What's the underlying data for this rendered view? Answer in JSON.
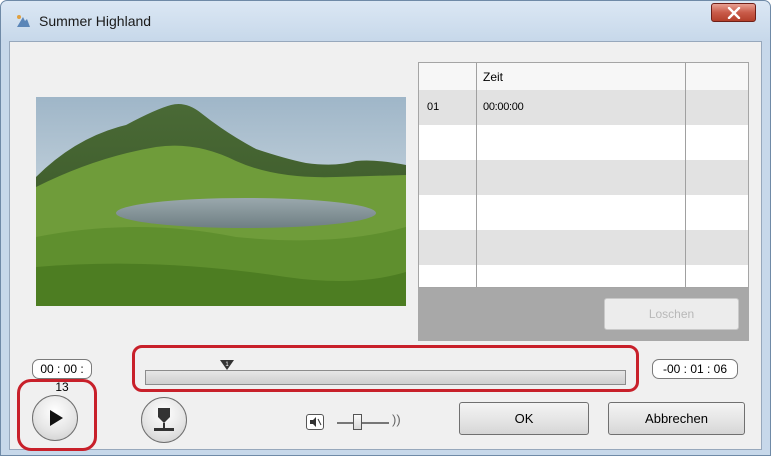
{
  "window": {
    "title": "Summer Highland",
    "close_icon": "close-icon"
  },
  "markers_table": {
    "columns": [
      "",
      "Zeit",
      ""
    ],
    "rows": [
      {
        "index": "01",
        "time": "00:00:00"
      },
      {
        "index": "",
        "time": ""
      },
      {
        "index": "",
        "time": ""
      },
      {
        "index": "",
        "time": ""
      },
      {
        "index": "",
        "time": ""
      },
      {
        "index": "",
        "time": ""
      }
    ],
    "delete_label": "Loschen"
  },
  "playback": {
    "elapsed": "00 : 00 : 13",
    "remaining": "-00 : 01 : 06",
    "marker_label": "1",
    "play_icon": "play-icon",
    "add_marker_icon": "add-marker-icon",
    "mute_icon": "mute-icon",
    "volume_icon": "volume-wave-icon"
  },
  "footer": {
    "ok_label": "OK",
    "cancel_label": "Abbrechen"
  },
  "colors": {
    "highlight": "#c8202a",
    "titlebar": "#c7d8ea",
    "close": "#c95b49"
  }
}
